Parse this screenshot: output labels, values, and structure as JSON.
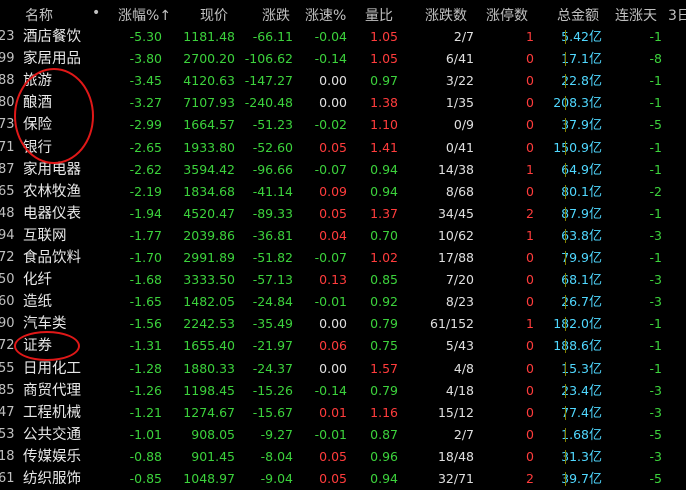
{
  "header": {
    "name": "名称",
    "dot": "•",
    "pct": "涨幅%",
    "sort_arrow": "↑",
    "price": "现价",
    "change": "涨跌",
    "speed": "涨速%",
    "vol_ratio": "量比",
    "up_down": "涨跌数",
    "limit_up": "涨停数",
    "amount": "总金额",
    "cont_days": "连涨天",
    "more": "3日"
  },
  "rows": [
    {
      "code": "23",
      "name": "酒店餐饮",
      "pct": "-5.30",
      "price": "1181.48",
      "chg": "-66.11",
      "spd": "-0.04",
      "vr": "1.05",
      "ud": "2/7",
      "lim": "1",
      "amt": "5.42",
      "unit": "亿",
      "cont": "-1"
    },
    {
      "code": "99",
      "name": "家居用品",
      "pct": "-3.80",
      "price": "2700.20",
      "chg": "-106.62",
      "spd": "-0.14",
      "vr": "1.05",
      "ud": "6/41",
      "lim": "0",
      "amt": "17.1",
      "unit": "亿",
      "cont": "-8"
    },
    {
      "code": "88",
      "name": "旅游",
      "pct": "-3.45",
      "price": "4120.63",
      "chg": "-147.27",
      "spd": "0.00",
      "vr": "0.97",
      "ud": "3/22",
      "lim": "0",
      "amt": "22.8",
      "unit": "亿",
      "cont": "-1"
    },
    {
      "code": "80",
      "name": "酿酒",
      "pct": "-3.27",
      "price": "7107.93",
      "chg": "-240.48",
      "spd": "0.00",
      "vr": "1.38",
      "ud": "1/35",
      "lim": "0",
      "amt": "208.3",
      "unit": "亿",
      "cont": "-1"
    },
    {
      "code": "73",
      "name": "保险",
      "pct": "-2.99",
      "price": "1664.57",
      "chg": "-51.23",
      "spd": "-0.02",
      "vr": "1.10",
      "ud": "0/9",
      "lim": "0",
      "amt": "37.9",
      "unit": "亿",
      "cont": "-5"
    },
    {
      "code": "71",
      "name": "银行",
      "pct": "-2.65",
      "price": "1933.80",
      "chg": "-52.60",
      "spd": "0.05",
      "vr": "1.41",
      "ud": "0/41",
      "lim": "0",
      "amt": "150.9",
      "unit": "亿",
      "cont": "-1"
    },
    {
      "code": "87",
      "name": "家用电器",
      "pct": "-2.62",
      "price": "3594.42",
      "chg": "-96.66",
      "spd": "-0.07",
      "vr": "0.94",
      "ud": "14/38",
      "lim": "1",
      "amt": "64.9",
      "unit": "亿",
      "cont": "-1"
    },
    {
      "code": "65",
      "name": "农林牧渔",
      "pct": "-2.19",
      "price": "1834.68",
      "chg": "-41.14",
      "spd": "0.09",
      "vr": "0.94",
      "ud": "8/68",
      "lim": "0",
      "amt": "80.1",
      "unit": "亿",
      "cont": "-2"
    },
    {
      "code": "48",
      "name": "电器仪表",
      "pct": "-1.94",
      "price": "4520.47",
      "chg": "-89.33",
      "spd": "0.05",
      "vr": "1.37",
      "ud": "34/45",
      "lim": "2",
      "amt": "87.9",
      "unit": "亿",
      "cont": "-1"
    },
    {
      "code": "94",
      "name": "互联网",
      "pct": "-1.77",
      "price": "2039.86",
      "chg": "-36.81",
      "spd": "0.04",
      "vr": "0.70",
      "ud": "10/62",
      "lim": "1",
      "amt": "63.8",
      "unit": "亿",
      "cont": "-3"
    },
    {
      "code": "72",
      "name": "食品饮料",
      "pct": "-1.70",
      "price": "2991.89",
      "chg": "-51.82",
      "spd": "-0.07",
      "vr": "1.02",
      "ud": "17/88",
      "lim": "0",
      "amt": "79.9",
      "unit": "亿",
      "cont": "-1"
    },
    {
      "code": "50",
      "name": "化纤",
      "pct": "-1.68",
      "price": "3333.50",
      "chg": "-57.13",
      "spd": "0.13",
      "vr": "0.85",
      "ud": "7/20",
      "lim": "0",
      "amt": "68.1",
      "unit": "亿",
      "cont": "-3"
    },
    {
      "code": "60",
      "name": "造纸",
      "pct": "-1.65",
      "price": "1482.05",
      "chg": "-24.84",
      "spd": "-0.01",
      "vr": "0.92",
      "ud": "8/23",
      "lim": "0",
      "amt": "26.7",
      "unit": "亿",
      "cont": "-3"
    },
    {
      "code": "90",
      "name": "汽车类",
      "pct": "-1.56",
      "price": "2242.53",
      "chg": "-35.49",
      "spd": "0.00",
      "vr": "0.79",
      "ud": "61/152",
      "lim": "1",
      "amt": "182.0",
      "unit": "亿",
      "cont": "-1"
    },
    {
      "code": "72",
      "name": "证券",
      "pct": "-1.31",
      "price": "1655.40",
      "chg": "-21.97",
      "spd": "0.06",
      "vr": "0.75",
      "ud": "5/43",
      "lim": "0",
      "amt": "188.6",
      "unit": "亿",
      "cont": "-1"
    },
    {
      "code": "55",
      "name": "日用化工",
      "pct": "-1.28",
      "price": "1880.33",
      "chg": "-24.37",
      "spd": "0.00",
      "vr": "1.57",
      "ud": "4/8",
      "lim": "0",
      "amt": "15.3",
      "unit": "亿",
      "cont": "-1"
    },
    {
      "code": "85",
      "name": "商贸代理",
      "pct": "-1.26",
      "price": "1198.45",
      "chg": "-15.26",
      "spd": "-0.14",
      "vr": "0.79",
      "ud": "4/18",
      "lim": "0",
      "amt": "23.4",
      "unit": "亿",
      "cont": "-3"
    },
    {
      "code": "47",
      "name": "工程机械",
      "pct": "-1.21",
      "price": "1274.67",
      "chg": "-15.67",
      "spd": "0.01",
      "vr": "1.16",
      "ud": "15/12",
      "lim": "0",
      "amt": "77.4",
      "unit": "亿",
      "cont": "-3"
    },
    {
      "code": "53",
      "name": "公共交通",
      "pct": "-1.01",
      "price": "908.05",
      "chg": "-9.27",
      "spd": "-0.01",
      "vr": "0.87",
      "ud": "2/7",
      "lim": "0",
      "amt": "1.68",
      "unit": "亿",
      "cont": "-5"
    },
    {
      "code": "18",
      "name": "传媒娱乐",
      "pct": "-0.88",
      "price": "901.45",
      "chg": "-8.04",
      "spd": "0.05",
      "vr": "0.96",
      "ud": "18/48",
      "lim": "0",
      "amt": "31.3",
      "unit": "亿",
      "cont": "-3"
    },
    {
      "code": "61",
      "name": "纺织服饰",
      "pct": "-0.85",
      "price": "1048.97",
      "chg": "-9.04",
      "spd": "0.05",
      "vr": "0.94",
      "ud": "32/71",
      "lim": "2",
      "amt": "39.7",
      "unit": "亿",
      "cont": "-5"
    }
  ]
}
